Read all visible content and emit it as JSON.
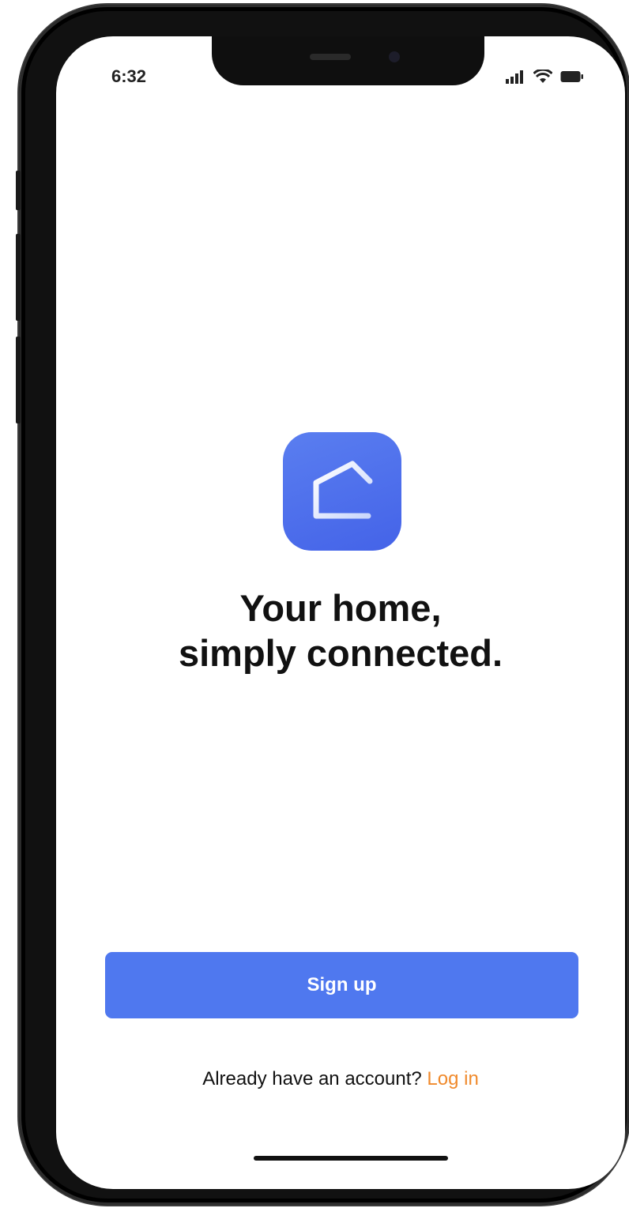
{
  "status_bar": {
    "time": "6:32",
    "icons": [
      "signal-icon",
      "wifi-icon",
      "battery-icon"
    ]
  },
  "app": {
    "logo_icon": "house-icon",
    "brand_color": "#4f78ef",
    "headline_line1": "Your home,",
    "headline_line2": "simply connected."
  },
  "actions": {
    "signup_label": "Sign up",
    "login_prompt": "Already have an account?",
    "login_link": "Log in",
    "link_color": "#f08a2c"
  }
}
